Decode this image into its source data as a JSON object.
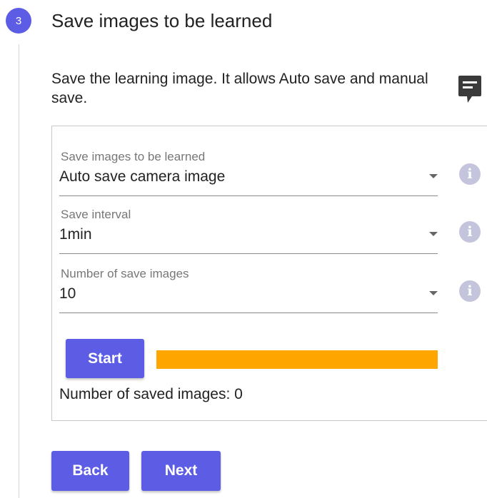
{
  "step": {
    "number": "3",
    "title": "Save images to be learned"
  },
  "description": "Save the learning image. It allows Auto save and manual save.",
  "icons": {
    "comment": "comment-icon",
    "info": "info-icon",
    "dropdown": "chevron-down-icon"
  },
  "fields": [
    {
      "label": "Save images to be learned",
      "value": "Auto save camera image",
      "info": "i"
    },
    {
      "label": "Save interval",
      "value": "1min",
      "info": "i"
    },
    {
      "label": "Number of save images",
      "value": "10",
      "info": "i"
    }
  ],
  "start_button": "Start",
  "progress": {
    "percent": 100,
    "color": "#ffa500"
  },
  "saved_images_text": "Number of saved images: 0",
  "nav": {
    "back": "Back",
    "next": "Next"
  },
  "colors": {
    "accent": "#5d5ce5",
    "progress": "#ffa500",
    "info_icon": "#c4c4dc"
  }
}
